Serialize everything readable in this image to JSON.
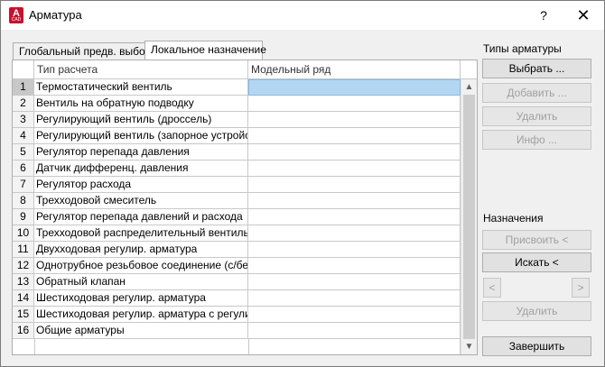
{
  "window": {
    "title": "Арматура",
    "app_icon_letter": "A",
    "app_icon_sub": "CAD",
    "help": "?",
    "close": "✕"
  },
  "tabs": [
    {
      "label": "Глобальный предв. выбор",
      "active": false
    },
    {
      "label": "Локальное назначение",
      "active": true
    }
  ],
  "table": {
    "columns": [
      "Тип расчета",
      "Модельный ряд"
    ],
    "rows": [
      {
        "num": "1",
        "type": "Термостатический вентиль",
        "model": ""
      },
      {
        "num": "2",
        "type": "Вентиль на обратную подводку",
        "model": ""
      },
      {
        "num": "3",
        "type": "Регулирующий вентиль (дроссель)",
        "model": ""
      },
      {
        "num": "4",
        "type": "Регулирующий вентиль (запорное устройст...",
        "model": ""
      },
      {
        "num": "5",
        "type": "Регулятор перепада давления",
        "model": ""
      },
      {
        "num": "6",
        "type": "Датчик дифференц. давления",
        "model": ""
      },
      {
        "num": "7",
        "type": "Регулятор расхода",
        "model": ""
      },
      {
        "num": "8",
        "type": "Трехходовой смеситель",
        "model": ""
      },
      {
        "num": "9",
        "type": "Регулятор перепада давлений и расхода",
        "model": ""
      },
      {
        "num": "10",
        "type": "Трехходовой распределительный вентиль",
        "model": ""
      },
      {
        "num": "11",
        "type": "Двухходовая регулир. арматура",
        "model": ""
      },
      {
        "num": "12",
        "type": "Однотрубное резьбовое соединение (с/без ...",
        "model": ""
      },
      {
        "num": "13",
        "type": "Обратный клапан",
        "model": ""
      },
      {
        "num": "14",
        "type": "Шестиходовая регулир. арматура",
        "model": ""
      },
      {
        "num": "15",
        "type": "Шестиходовая регулир. арматура с регулир...",
        "model": ""
      },
      {
        "num": "16",
        "type": "Общие арматуры",
        "model": ""
      }
    ],
    "selected_row": "1"
  },
  "scrollbar": {
    "up": "▲",
    "down": "▼"
  },
  "types_panel": {
    "label": "Типы арматуры",
    "select": "Выбрать ...",
    "add": "Добавить ...",
    "delete": "Удалить",
    "info": "Инфо ..."
  },
  "assign_panel": {
    "label": "Назначения",
    "assign": "Присвоить  <",
    "search": "Искать <",
    "prev": "<",
    "next": ">",
    "delete": "Удалить"
  },
  "finish": "Завершить"
}
